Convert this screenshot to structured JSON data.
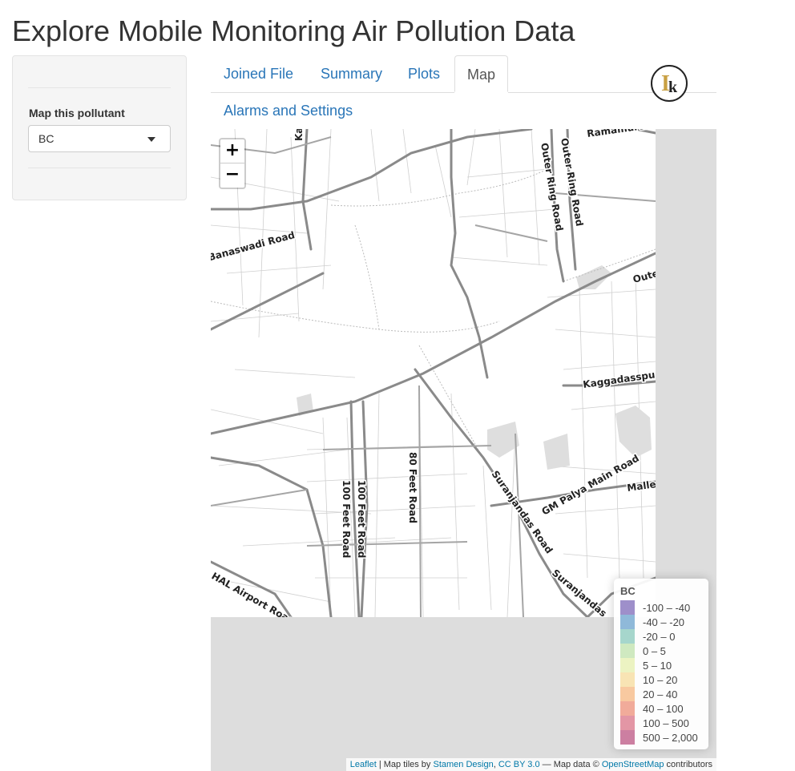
{
  "title": "Explore Mobile Monitoring Air Pollution Data",
  "sidebar": {
    "label": "Map this pollutant",
    "select_value": "BC"
  },
  "tabs": [
    {
      "label": "Joined File",
      "active": false
    },
    {
      "label": "Summary",
      "active": false
    },
    {
      "label": "Plots",
      "active": false
    },
    {
      "label": "Map",
      "active": true
    },
    {
      "label": "Alarms and Settings",
      "active": false
    }
  ],
  "map": {
    "zoom_in": "+",
    "zoom_out": "−",
    "road_labels": [
      "Banaswadi Road",
      "Outer Ring Road",
      "Kammanahalli",
      "Outer",
      "Kaggadasspura M",
      "80 Feet Road",
      "100 Feet Road",
      "100 Feet Road",
      "Suranjandas Road",
      "GM Palya Main Road",
      "Mallesh",
      "Suranjandas",
      "HAL Airport Road",
      "Ramamurthi",
      "Kamm"
    ],
    "legend": {
      "title": "BC",
      "items": [
        {
          "label": "-100 – -40",
          "color": "#9e8fca"
        },
        {
          "label": "-40 – -20",
          "color": "#8fb9d9"
        },
        {
          "label": "-20 – 0",
          "color": "#a6d6cc"
        },
        {
          "label": "0 – 5",
          "color": "#cfe9c0"
        },
        {
          "label": "5 – 10",
          "color": "#ecf3c2"
        },
        {
          "label": "10 – 20",
          "color": "#f8e4b4"
        },
        {
          "label": "20 – 40",
          "color": "#f8c9a0"
        },
        {
          "label": "40 – 100",
          "color": "#f1ab9a"
        },
        {
          "label": "100 – 500",
          "color": "#e396a5"
        },
        {
          "label": "500 – 2,000",
          "color": "#cc7fa1"
        }
      ]
    },
    "attribution": {
      "leaflet": "Leaflet",
      "sep1": " | Map tiles by ",
      "stamen": "Stamen Design",
      "sep2": ", ",
      "cc": "CC BY 3.0",
      "sep3": " — Map data © ",
      "osm": "OpenStreetMap",
      "sep4": " contributors"
    }
  }
}
